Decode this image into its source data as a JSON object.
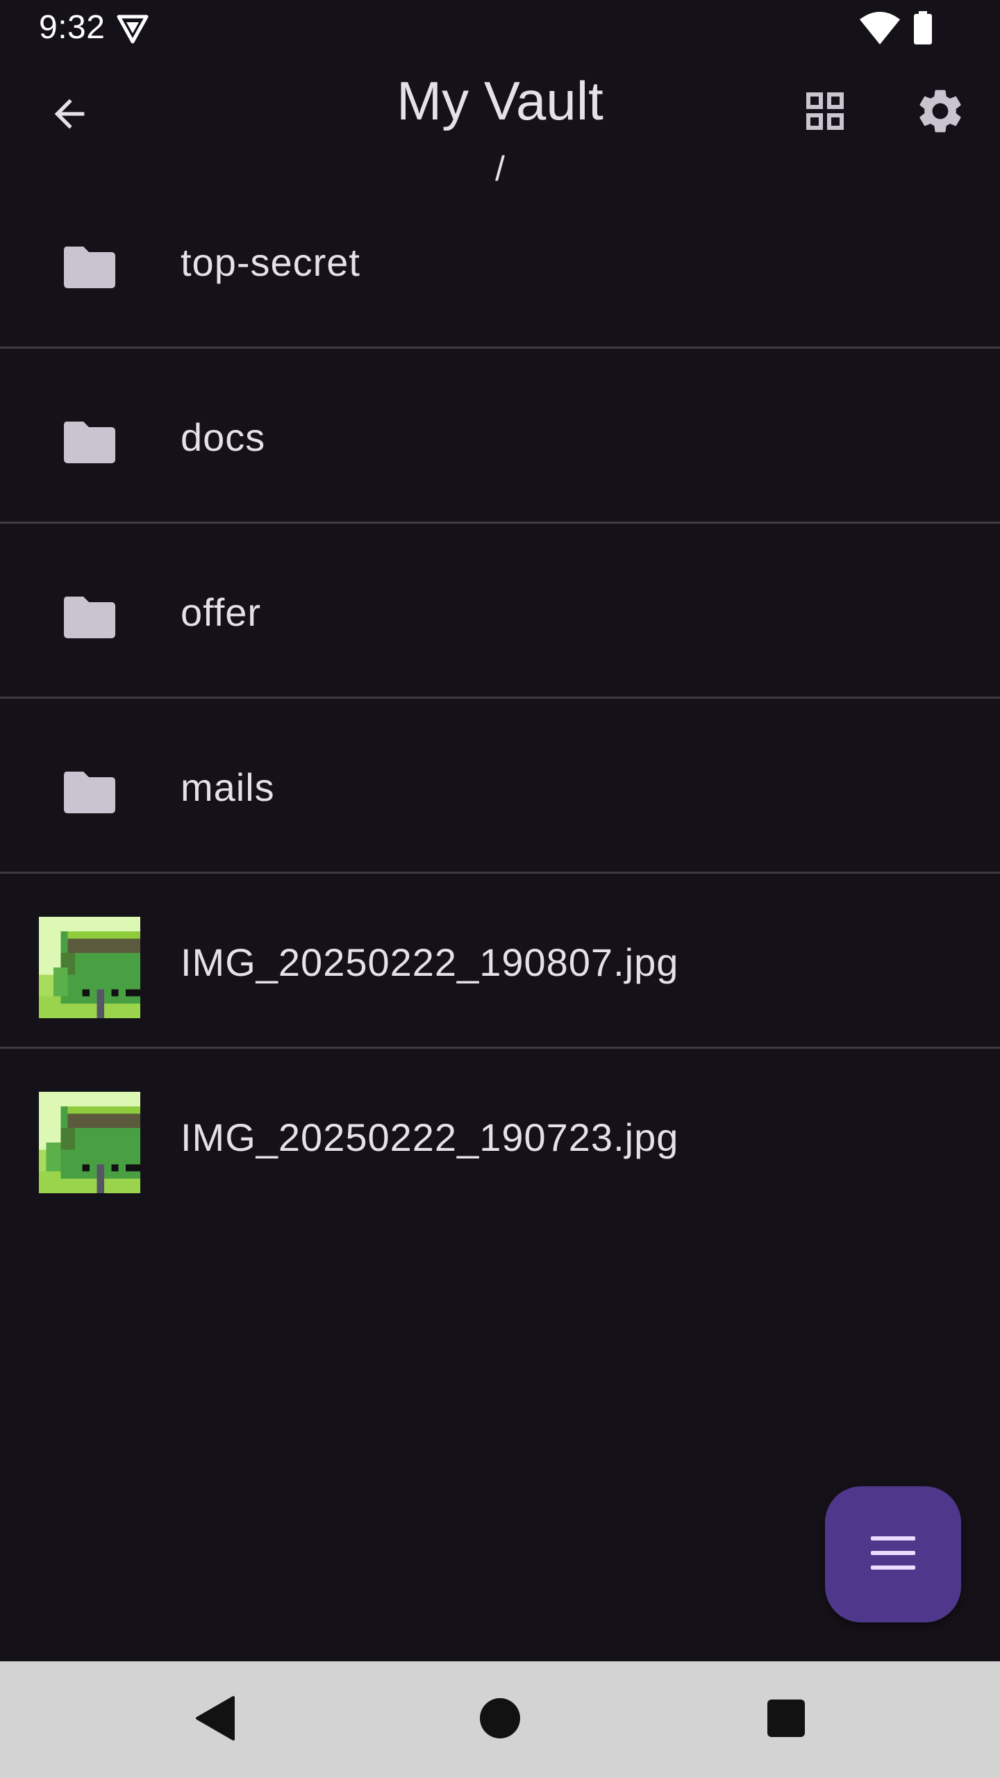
{
  "status_bar": {
    "time": "9:32",
    "icons": [
      "shield-icon",
      "wifi-icon",
      "battery-icon"
    ]
  },
  "app_bar": {
    "title": "My Vault",
    "path": "/",
    "back_icon": "arrow-back-icon",
    "actions": [
      "grid-view-icon",
      "settings-icon"
    ]
  },
  "files": [
    {
      "name": "top-secret",
      "type": "folder",
      "icon": "folder-icon"
    },
    {
      "name": "docs",
      "type": "folder",
      "icon": "folder-icon"
    },
    {
      "name": "offer",
      "type": "folder",
      "icon": "folder-icon"
    },
    {
      "name": "mails",
      "type": "folder",
      "icon": "folder-icon"
    },
    {
      "name": "IMG_20250222_190807.jpg",
      "type": "image",
      "icon": "image-thumbnail"
    },
    {
      "name": "IMG_20250222_190723.jpg",
      "type": "image",
      "icon": "image-thumbnail"
    }
  ],
  "fab": {
    "icon": "menu-icon"
  },
  "nav_bar": {
    "icons": [
      "nav-back-icon",
      "nav-home-icon",
      "nav-recents-icon"
    ]
  },
  "colors": {
    "background": "#141218",
    "text": "#e6e0e9",
    "divider": "#3e3b43",
    "fab": "#4f378b",
    "icon": "#cac4d0",
    "nav_bar": "#d3d3d3"
  }
}
